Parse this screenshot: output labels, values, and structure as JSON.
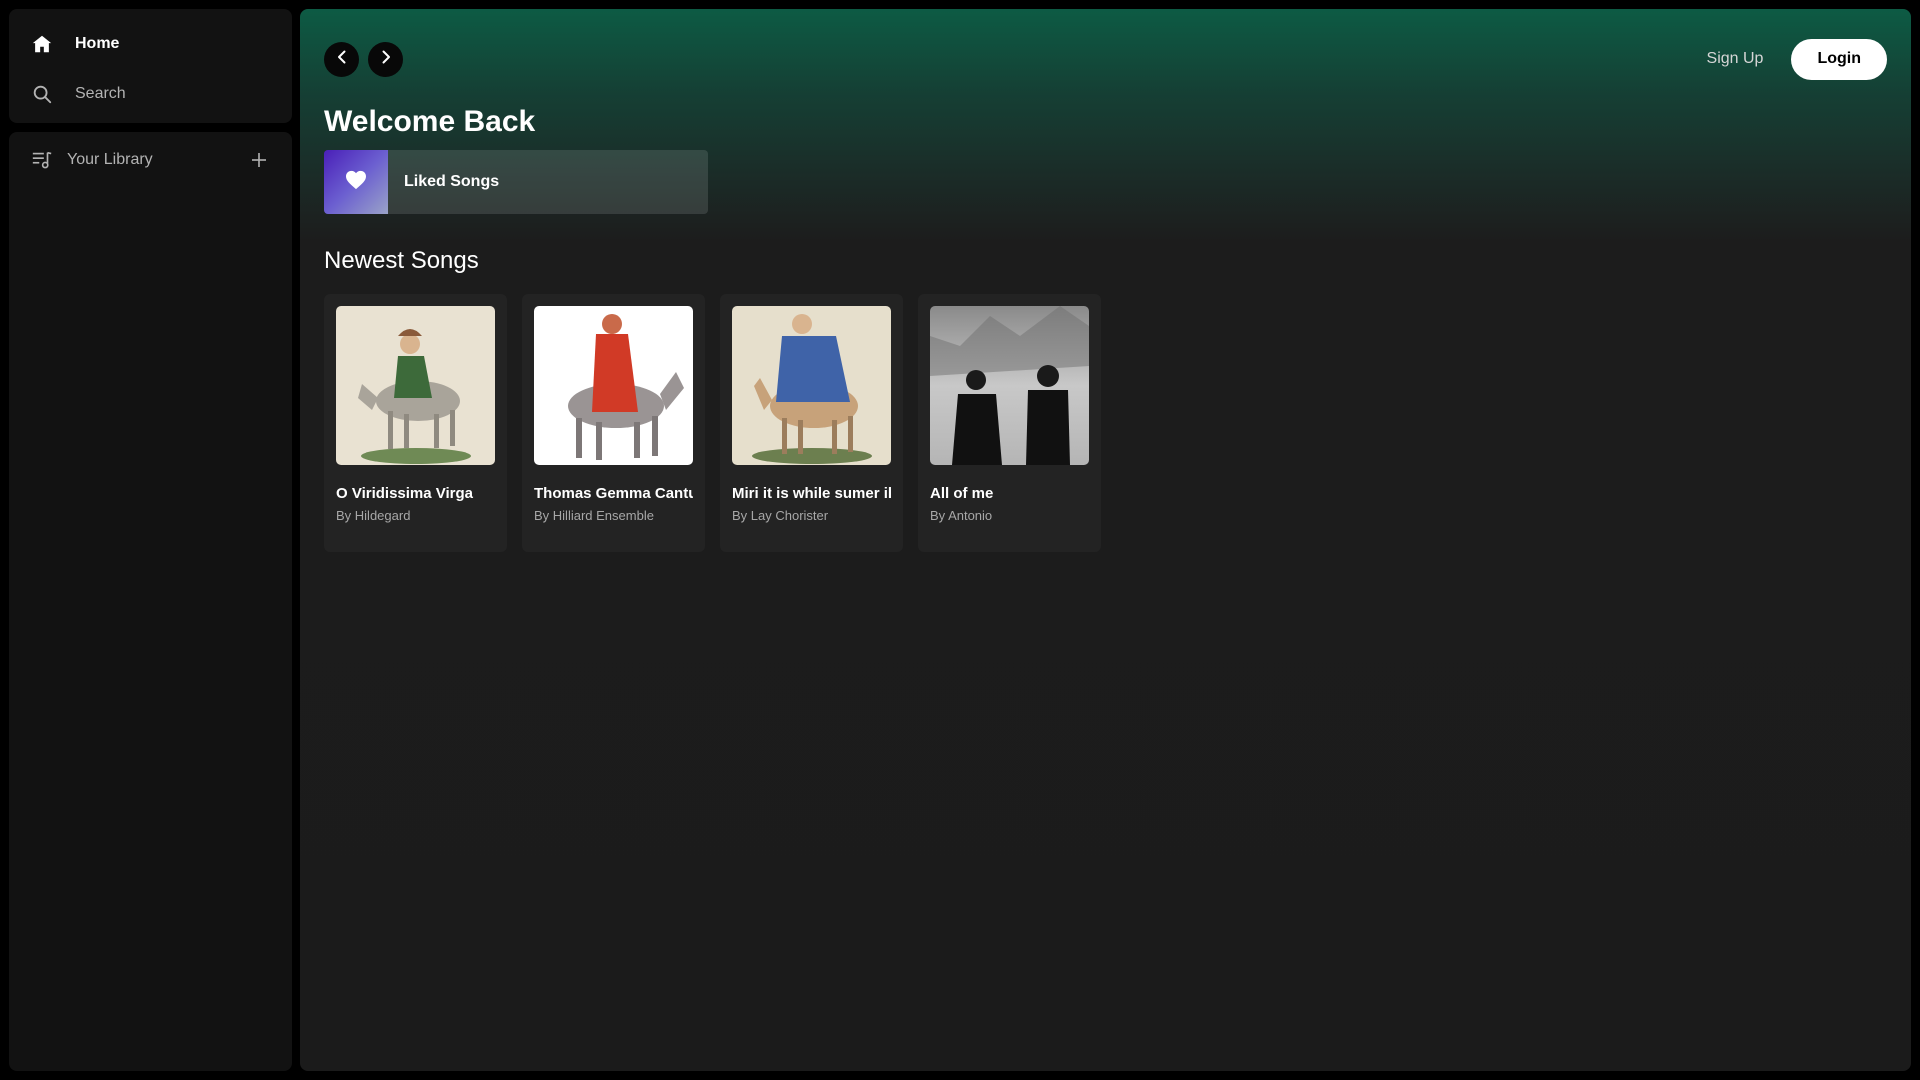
{
  "sidebar": {
    "nav": [
      {
        "label": "Home",
        "icon": "home-icon"
      },
      {
        "label": "Search",
        "icon": "search-icon"
      }
    ],
    "library": {
      "label": "Your Library",
      "icon": "library-icon",
      "add_icon": "plus-icon"
    }
  },
  "header": {
    "back_icon": "chevron-left-icon",
    "forward_icon": "chevron-right-icon",
    "signup_label": "Sign Up",
    "login_label": "Login"
  },
  "main": {
    "welcome": "Welcome Back",
    "liked": {
      "label": "Liked Songs",
      "icon": "heart-icon"
    },
    "section_title": "Newest Songs",
    "songs": [
      {
        "title": "O Viridissima Virga",
        "artist": "By Hildegard"
      },
      {
        "title": "Thomas Gemma Cantuariae",
        "artist": "By Hilliard Ensemble"
      },
      {
        "title": "Miri it is while sumer ilast",
        "artist": "By Lay Chorister"
      },
      {
        "title": "All of me",
        "artist": "By Antonio"
      }
    ]
  },
  "colors": {
    "accent_green": "#0d5b44",
    "panel_bg": "#121212",
    "card_bg": "#232323"
  }
}
